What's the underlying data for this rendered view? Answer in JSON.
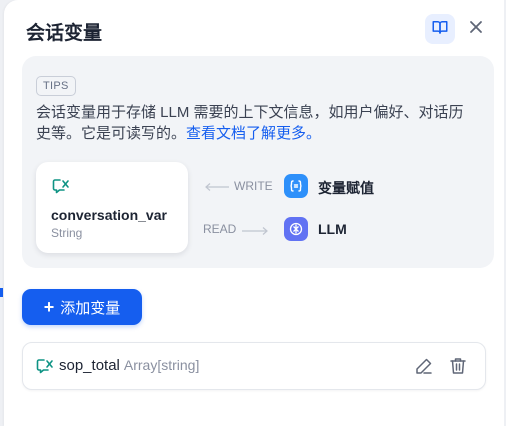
{
  "panel": {
    "title": "会话变量",
    "book_icon": "book-open-icon",
    "close_icon": "close-icon"
  },
  "tips": {
    "badge": "TIPS",
    "text": "会话变量用于存储 LLM 需要的上下文信息，如用户偏好、对话历史等。它是可读写的。",
    "link": "查看文档了解更多。",
    "card": {
      "name": "conversation_var",
      "type": "String",
      "icon": "conversation-variable-icon"
    },
    "write_label": "WRITE",
    "read_label": "READ",
    "assigner_label": "变量赋值",
    "llm_label": "LLM",
    "colors": {
      "accent": "#155eef",
      "assigner": "#2e90fa",
      "llm": "#6172f3",
      "var_green": "#0e9384"
    }
  },
  "add_button": {
    "label": "添加变量",
    "icon": "plus-icon"
  },
  "variables": [
    {
      "name": "sop_total",
      "type": "Array[string]",
      "icon": "conversation-variable-icon"
    }
  ]
}
